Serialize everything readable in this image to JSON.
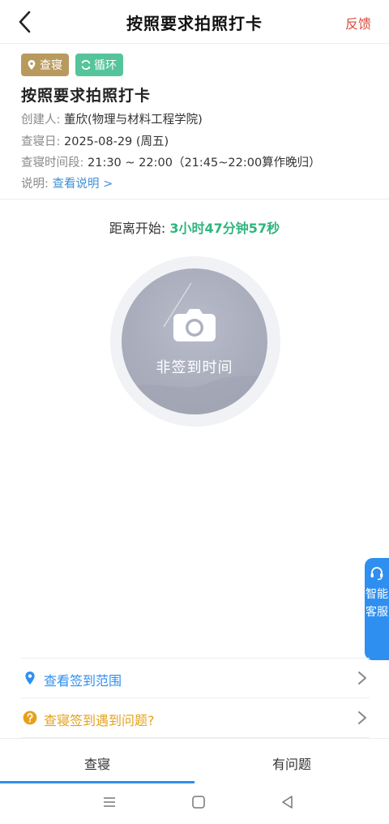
{
  "header": {
    "title": "按照要求拍照打卡",
    "feedback_label": "反馈"
  },
  "tags": [
    {
      "label": "查寝",
      "icon": "location-pin-icon",
      "color": "#b89a5e"
    },
    {
      "label": "循环",
      "icon": "refresh-icon",
      "color": "#55c49b"
    }
  ],
  "task": {
    "title": "按照要求拍照打卡",
    "creator_label": "创建人:",
    "creator_value": "董欣(物理与材料工程学院)",
    "date_label": "查寝日:",
    "date_value": "2025-08-29 (周五)",
    "time_label": "查寝时间段:",
    "time_value": "21:30 ~ 22:00（21:45~22:00算作晚归）",
    "desc_label": "说明:",
    "desc_link": "查看说明 >"
  },
  "countdown": {
    "label": "距离开始:",
    "value": "3小时47分钟57秒"
  },
  "checkin": {
    "button_text": "非签到时间",
    "icon": "camera-icon"
  },
  "service": {
    "label": "智能客服",
    "icon": "headset-icon"
  },
  "actions": [
    {
      "label": "查看签到范围",
      "icon": "location-pin-icon",
      "color": "#2f8ff0"
    },
    {
      "label": "查寝签到遇到问题?",
      "icon": "question-circle-icon",
      "color": "#e6a11a"
    }
  ],
  "bottom_tabs": [
    {
      "label": "查寝",
      "active": true
    },
    {
      "label": "有问题",
      "active": false
    }
  ],
  "colors": {
    "accent": "#2f8ff0",
    "countdown": "#2cb67d",
    "feedback": "#d84b3e"
  }
}
